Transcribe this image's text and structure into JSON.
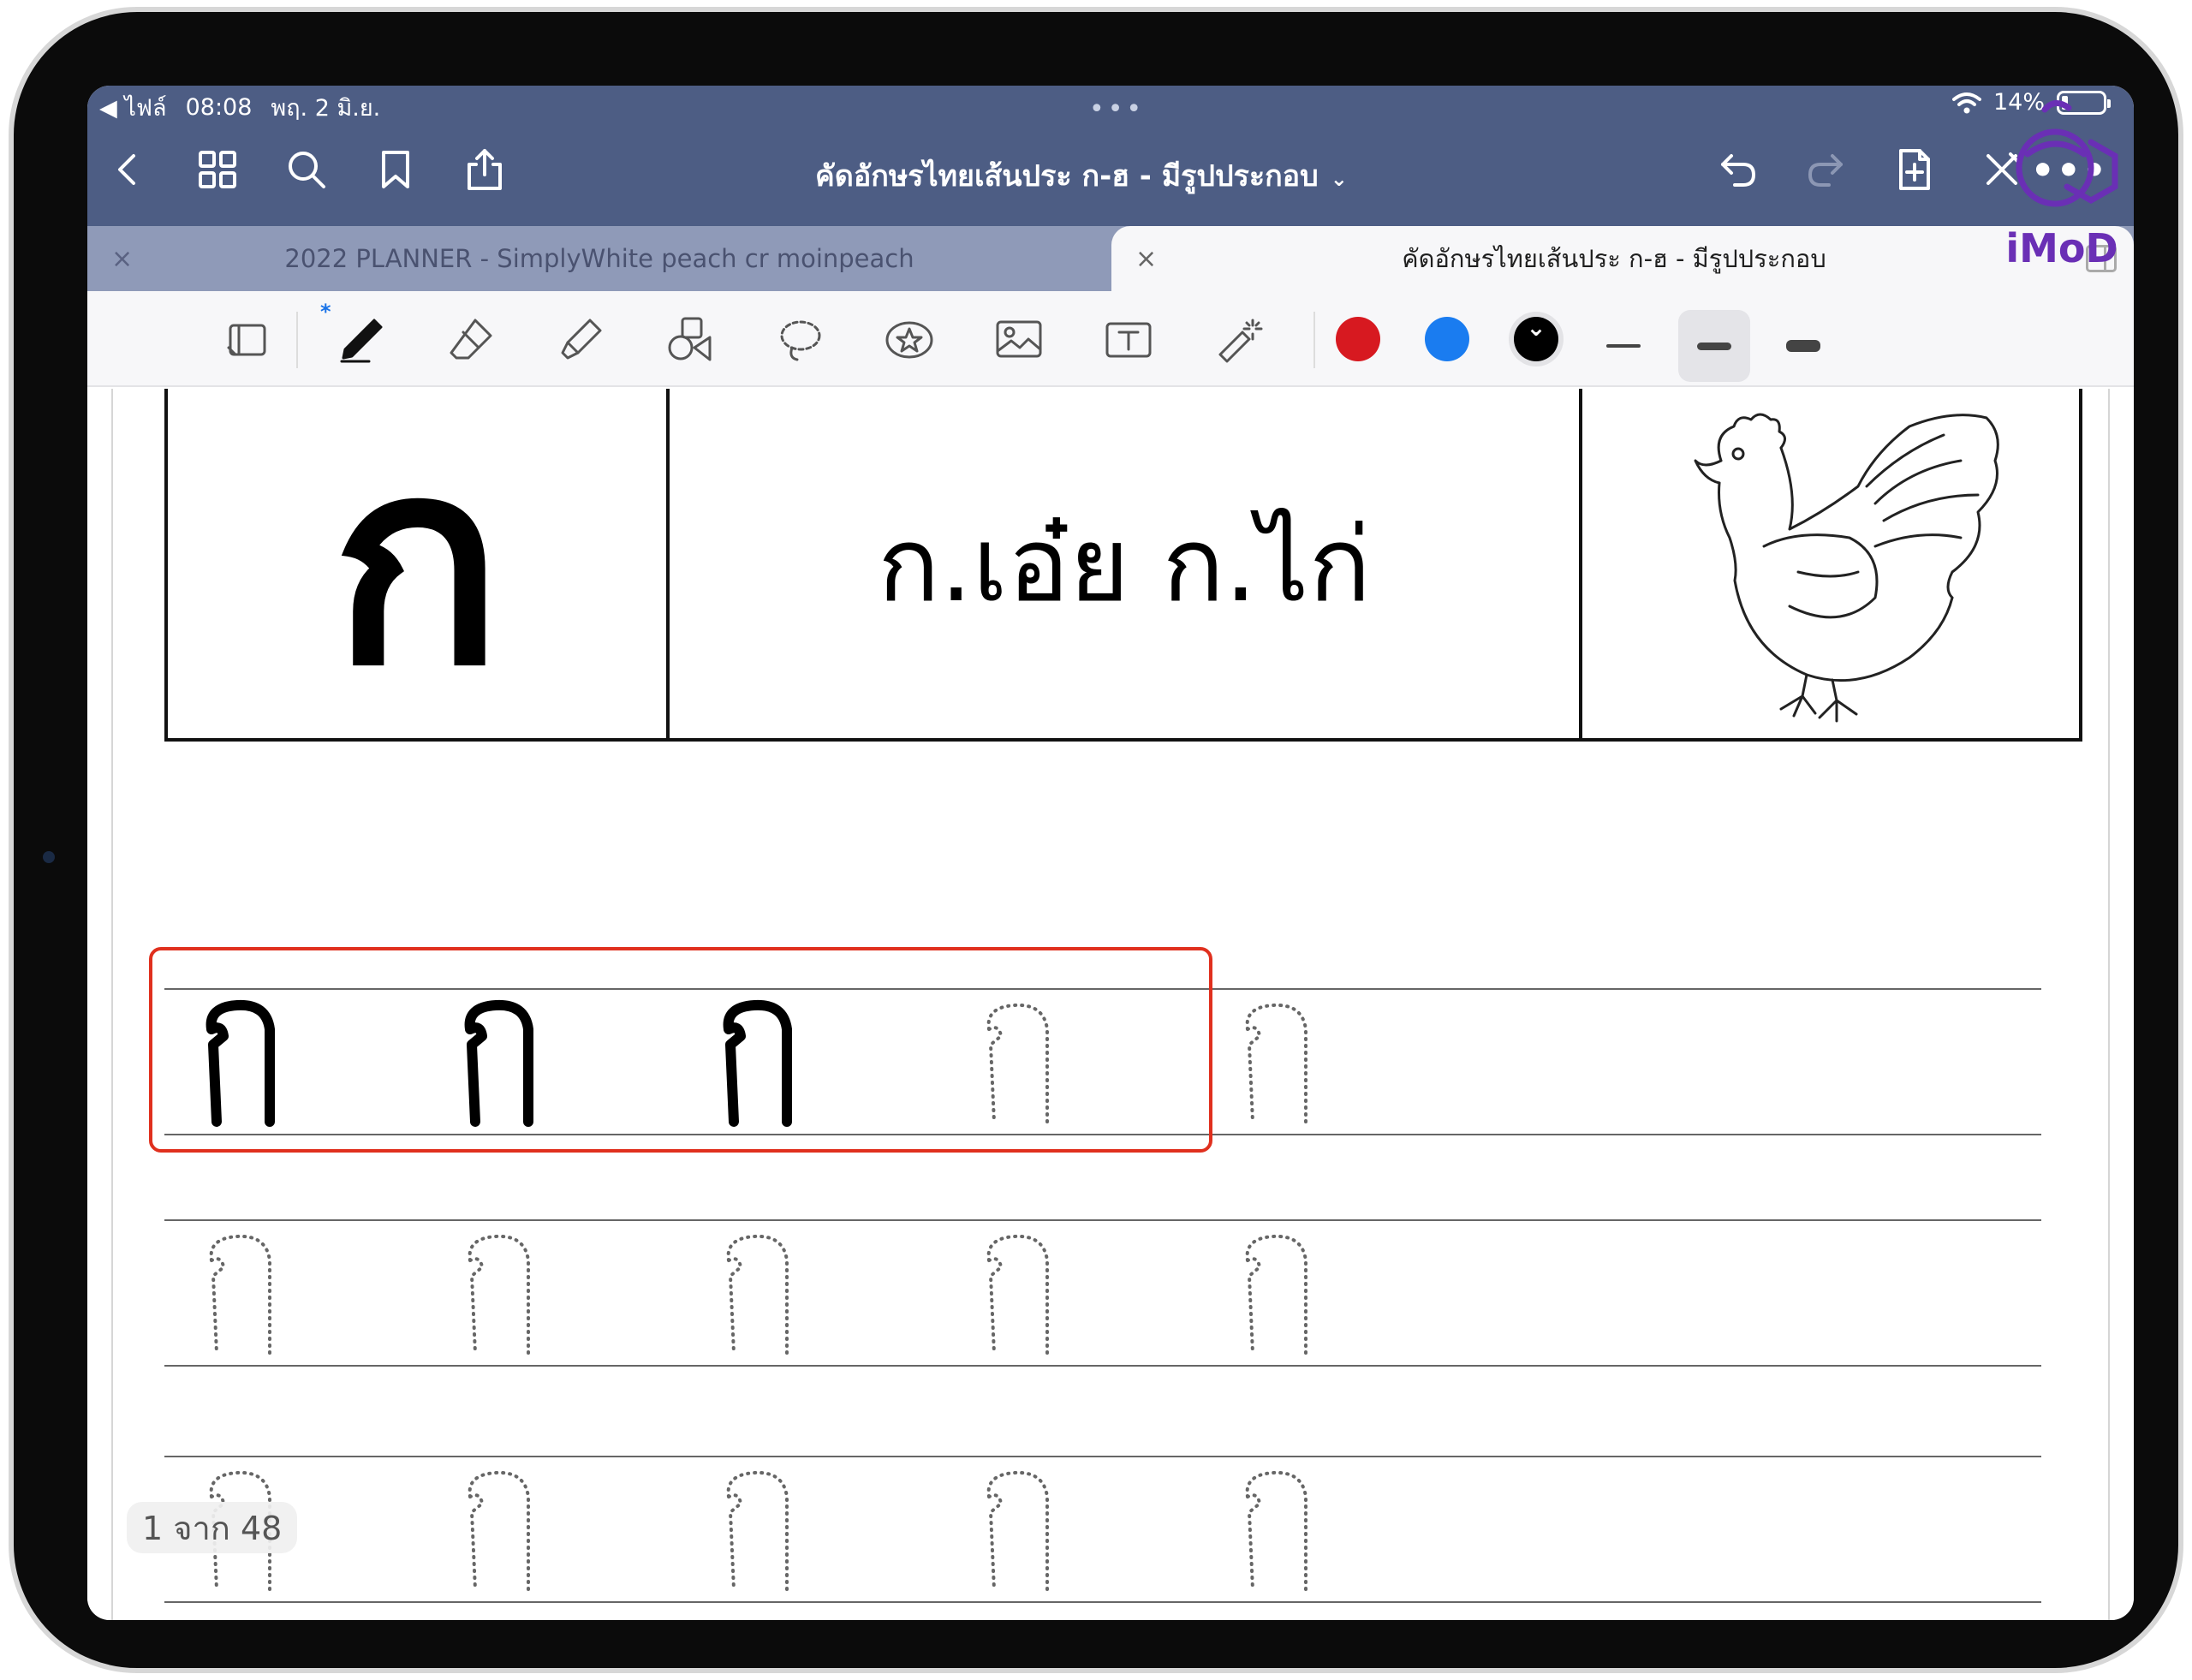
{
  "status_bar": {
    "back_app": "◀ ไฟล์",
    "time": "08:08",
    "date": "พฤ. 2 มิ.ย.",
    "multitask_dots": "•••",
    "battery": "14%"
  },
  "navbar": {
    "title": "คัดอักษรไทยเส้นประ ก-ฮ - มีรูปประกอบ",
    "title_chevron": "⌄",
    "more": "•••"
  },
  "tabs": [
    {
      "label": "2022 PLANNER - SimplyWhite peach cr moinpeach",
      "close": "×",
      "active": false
    },
    {
      "label": "คัดอักษรไทยเส้นประ ก-ฮ - มีรูปประกอบ",
      "close": "×",
      "active": true
    }
  ],
  "toolbar": {
    "bluetooth": "*",
    "colors": [
      "#d71920",
      "#1a7cf0",
      "#000000"
    ],
    "stroke_widths": [
      "thin",
      "medium",
      "thick"
    ],
    "selected_stroke": "medium"
  },
  "worksheet": {
    "letter": "ก",
    "word": "ก.เอ๋ย ก.ไก่",
    "practice_letter": "ก",
    "handwritten_count": 3,
    "rows": 3,
    "slots_per_row": 5
  },
  "page_indicator": "1 จาก 48",
  "watermark": "iMoD",
  "theme": {
    "nav_bg": "#4d5d84",
    "tab_bar_bg": "#8f9ab8",
    "highlight": "#e0301e"
  }
}
